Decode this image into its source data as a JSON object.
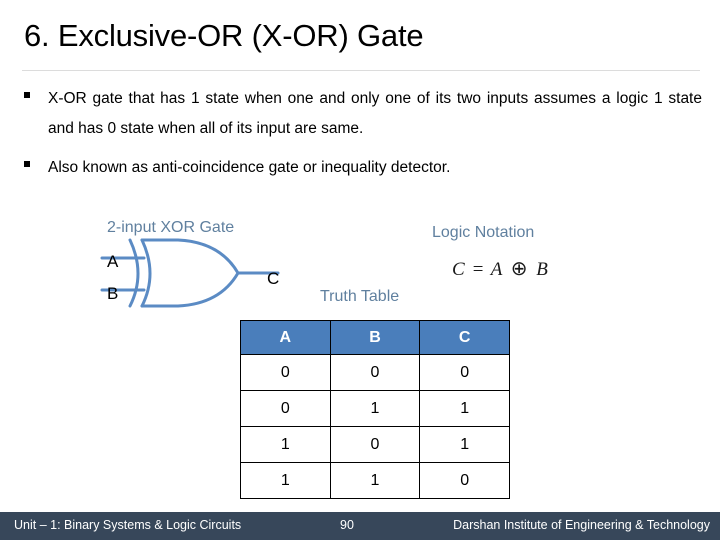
{
  "slide": {
    "title": "6. Exclusive-OR (X-OR) Gate",
    "bullets": [
      "X-OR gate that has 1 state when one and only one of its two inputs assumes a logic 1 state and has 0 state when all of its input are same.",
      "Also known as anti-coincidence gate or inequality detector."
    ]
  },
  "diagram": {
    "gate_caption": "2-input XOR Gate",
    "input_a_label": "A",
    "input_b_label": "B",
    "output_label": "C",
    "gate_color": "#5b8bc4"
  },
  "logic": {
    "caption": "Logic Notation",
    "formula_lhs": "C",
    "formula_eq": "=",
    "formula_operand_a": "A",
    "formula_operator": "⊕",
    "formula_operand_b": "B"
  },
  "truth_table": {
    "caption": "Truth Table",
    "headers": [
      "A",
      "B",
      "C"
    ],
    "rows": [
      [
        "0",
        "0",
        "0"
      ],
      [
        "0",
        "1",
        "1"
      ],
      [
        "1",
        "0",
        "1"
      ],
      [
        "1",
        "1",
        "0"
      ]
    ],
    "header_color": "#4a7ebb"
  },
  "footer": {
    "left": "Unit – 1: Binary Systems & Logic Circuits",
    "page": "90",
    "right": "Darshan Institute of Engineering & Technology",
    "background": "#37475a"
  }
}
